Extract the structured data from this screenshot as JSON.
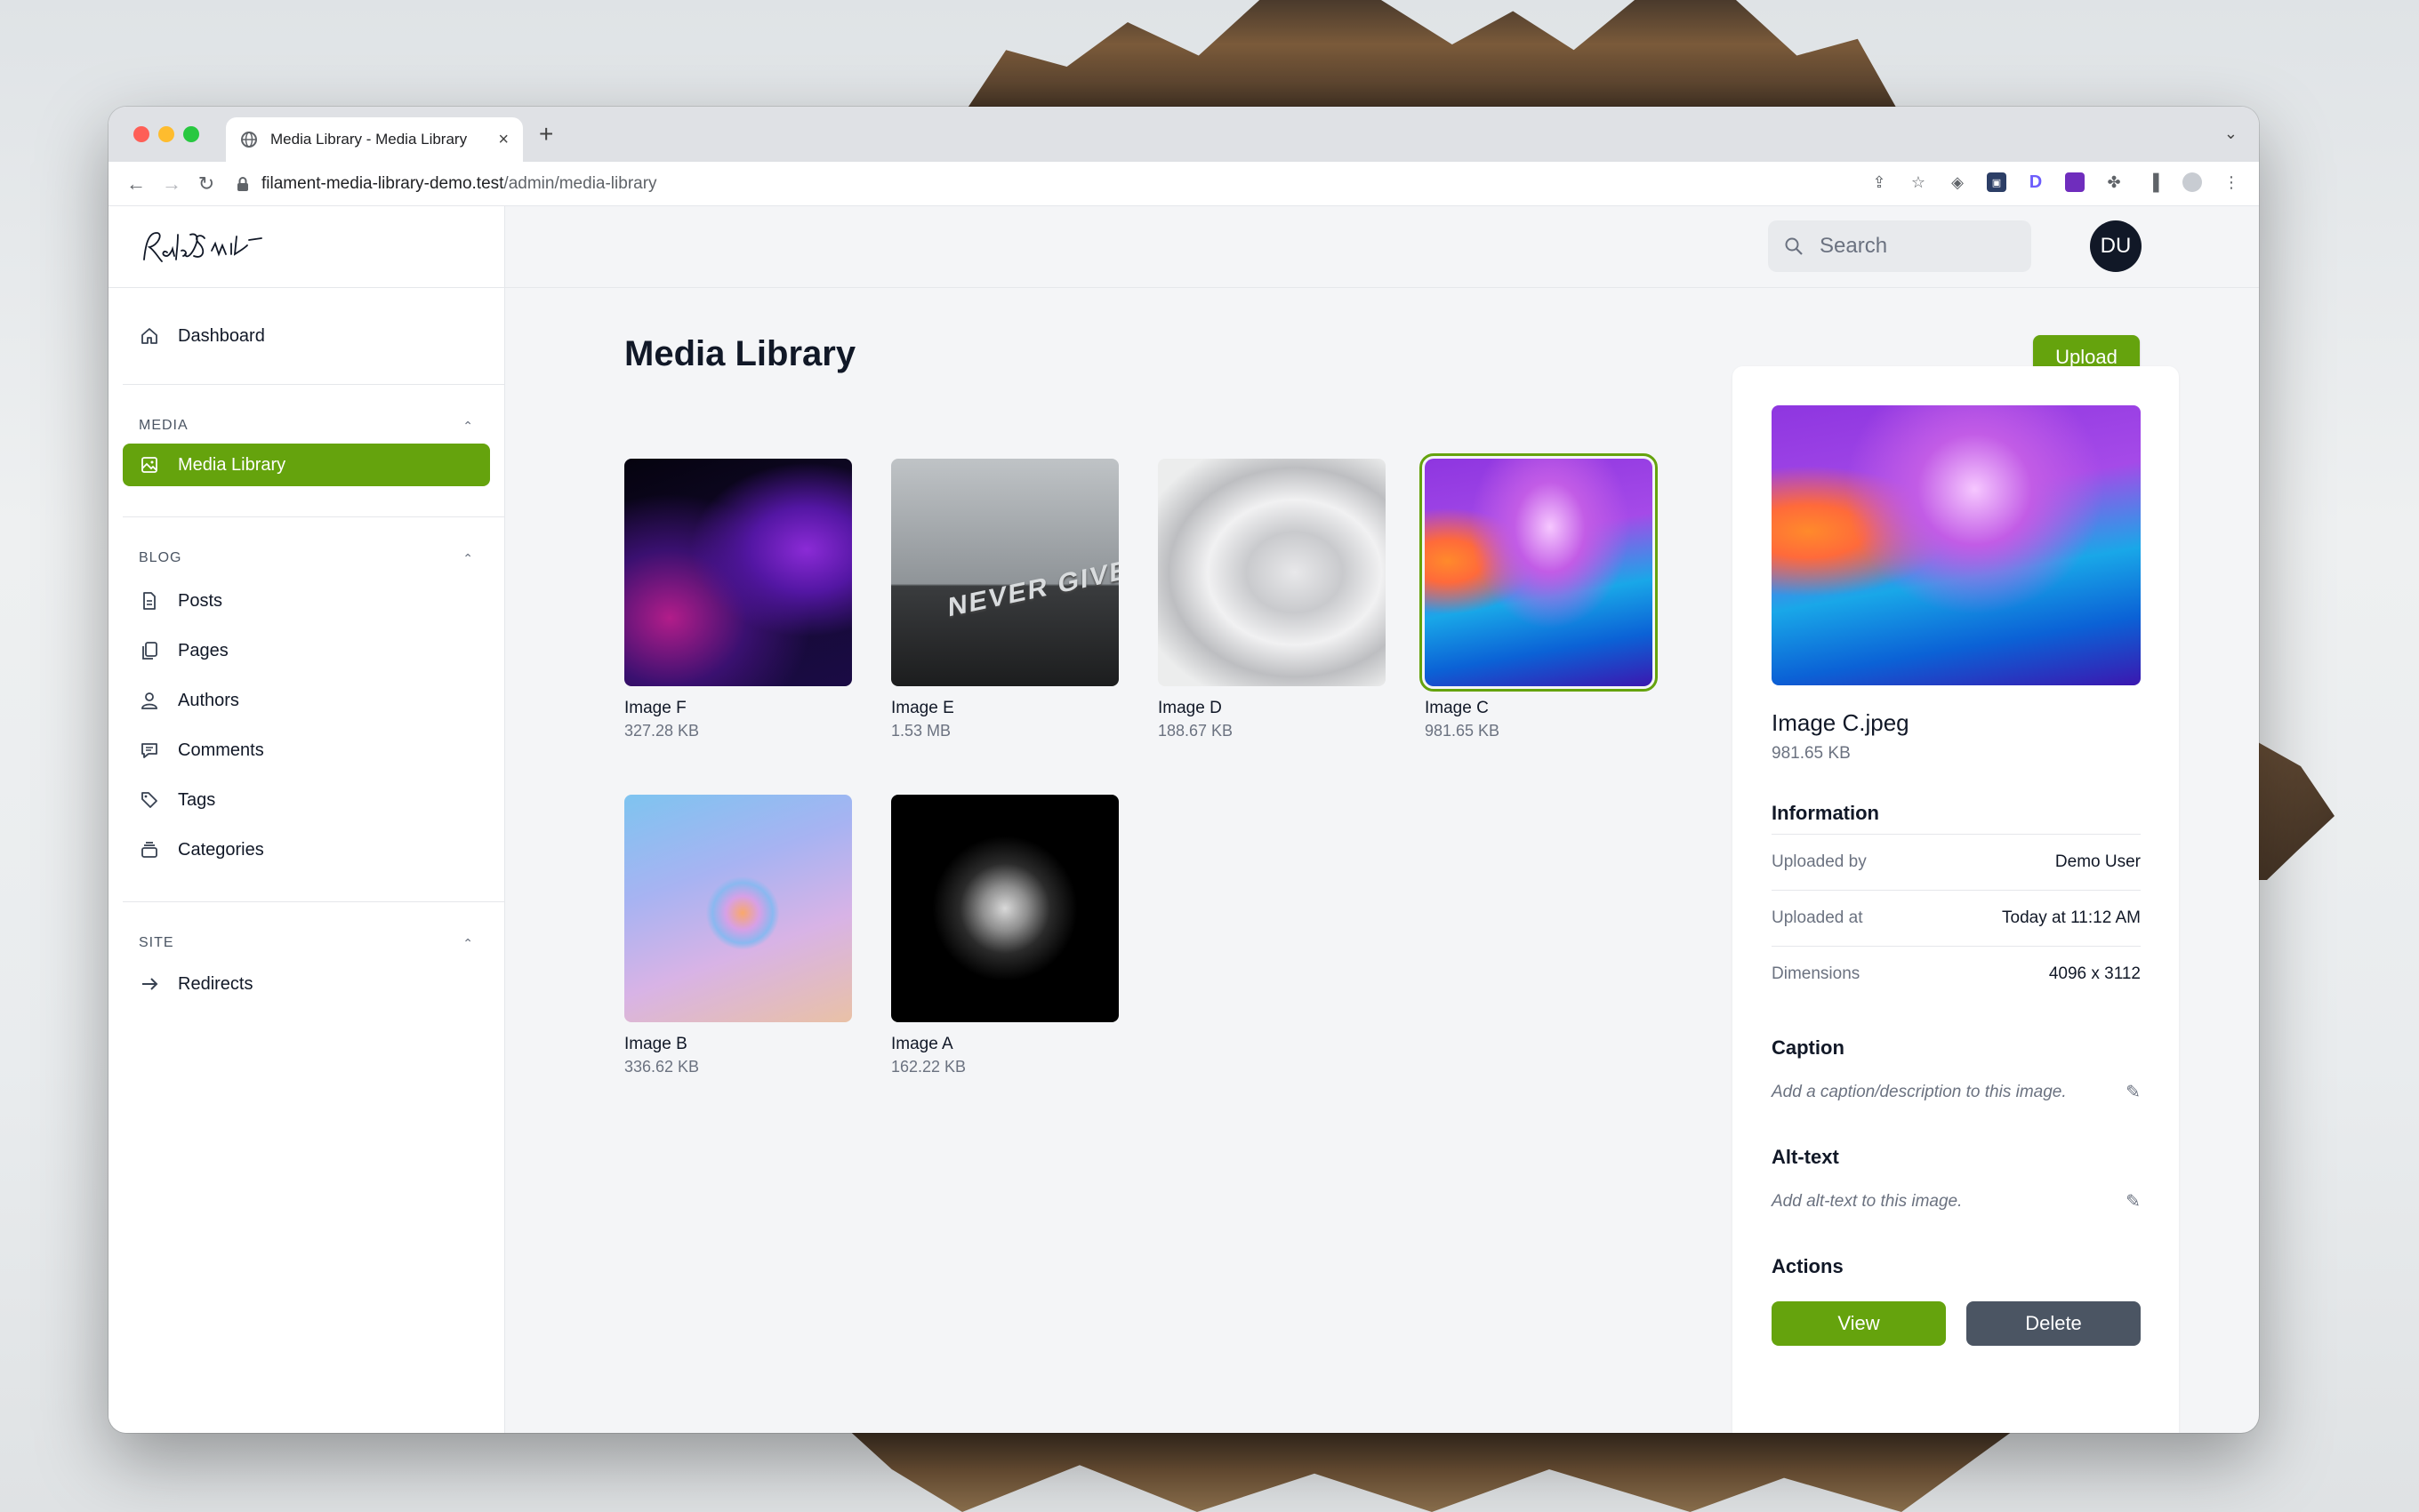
{
  "browser": {
    "tab_title": "Media Library - Media Library",
    "tab_close": "×",
    "new_tab": "+",
    "url_host": "filament-media-library-demo.test",
    "url_path": "/admin/media-library"
  },
  "sidebar": {
    "brand": "Ralph J Smit",
    "dashboard": "Dashboard",
    "groups": [
      {
        "label": "MEDIA",
        "items": [
          "Media Library"
        ]
      },
      {
        "label": "BLOG",
        "items": [
          "Posts",
          "Pages",
          "Authors",
          "Comments",
          "Tags",
          "Categories"
        ]
      },
      {
        "label": "SITE",
        "items": [
          "Redirects"
        ]
      }
    ]
  },
  "header": {
    "search_placeholder": "Search",
    "avatar_initials": "DU"
  },
  "main": {
    "title": "Media Library",
    "upload_label": "Upload",
    "items": [
      {
        "name": "Image F",
        "size": "327.28 KB"
      },
      {
        "name": "Image E",
        "size": "1.53 MB",
        "overlay_text": "NEVER GIVE UP"
      },
      {
        "name": "Image D",
        "size": "188.67 KB"
      },
      {
        "name": "Image C",
        "size": "981.65 KB",
        "selected": true
      },
      {
        "name": "Image B",
        "size": "336.62 KB"
      },
      {
        "name": "Image A",
        "size": "162.22 KB"
      }
    ]
  },
  "details": {
    "file_name": "Image C.jpeg",
    "file_size": "981.65 KB",
    "information_label": "Information",
    "rows": [
      {
        "key": "Uploaded by",
        "value": "Demo User"
      },
      {
        "key": "Uploaded at",
        "value": "Today at 11:12 AM"
      },
      {
        "key": "Dimensions",
        "value": "4096 x 3112"
      }
    ],
    "caption_label": "Caption",
    "caption_placeholder": "Add a caption/description to this image.",
    "alt_label": "Alt-text",
    "alt_placeholder": "Add alt-text to this image.",
    "actions_label": "Actions",
    "view_label": "View",
    "delete_label": "Delete"
  },
  "colors": {
    "accent": "#65a30d",
    "delete": "#4b5563",
    "avatar_bg": "#111827"
  }
}
